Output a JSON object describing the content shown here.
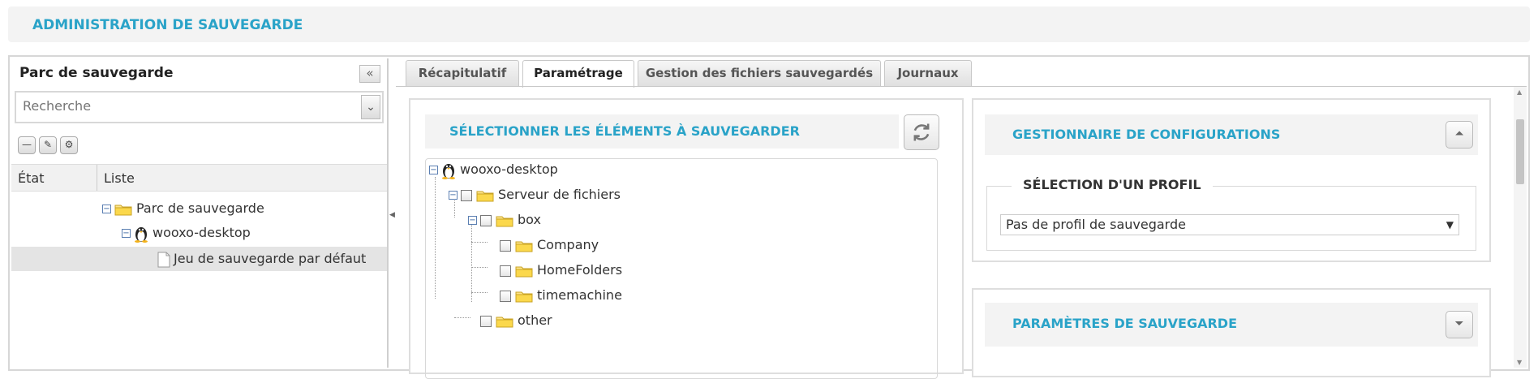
{
  "header": {
    "title": "ADMINISTRATION DE SAUVEGARDE"
  },
  "left": {
    "title": "Parc de sauvegarde",
    "collapse_icon": "double-chevron-left-icon",
    "search": {
      "placeholder": "Recherche",
      "value": ""
    },
    "tools": [
      "minus-icon",
      "pencil-icon",
      "gear-icon"
    ],
    "columns": [
      "État",
      "Liste"
    ],
    "tree": [
      {
        "label": "Parc de sauvegarde",
        "icon": "folder-icon",
        "expanded": true
      },
      {
        "label": "wooxo-desktop",
        "icon": "linux-icon",
        "expanded": true
      },
      {
        "label": "Jeu de sauvegarde par défaut",
        "icon": "document-icon",
        "selected": true
      }
    ]
  },
  "tabs": [
    {
      "label": "Récapitulatif",
      "active": false
    },
    {
      "label": "Paramétrage",
      "active": true
    },
    {
      "label": "Gestion des fichiers sauvegardés",
      "active": false
    },
    {
      "label": "Journaux",
      "active": false
    }
  ],
  "select_panel": {
    "title": "SÉLECTIONNER LES ÉLÉMENTS À SAUVEGARDER",
    "refresh_icon": "refresh-icon",
    "tree": {
      "root": "wooxo-desktop",
      "server": "Serveur de fichiers",
      "box": "box",
      "box_children": [
        "Company",
        "HomeFolders",
        "timemachine"
      ],
      "other": "other"
    }
  },
  "config_panel": {
    "title": "GESTIONNAIRE DE CONFIGURATIONS",
    "collapse_icon": "double-chevron-up-icon",
    "legend": "SÉLECTION D'UN PROFIL",
    "profile_value": "Pas de profil de sauvegarde"
  },
  "params_panel": {
    "title": "PARAMÈTRES DE SAUVEGARDE",
    "expand_icon": "double-chevron-down-icon"
  },
  "colors": {
    "accent": "#2aa3c8",
    "header_bg": "#f3f3f3"
  }
}
